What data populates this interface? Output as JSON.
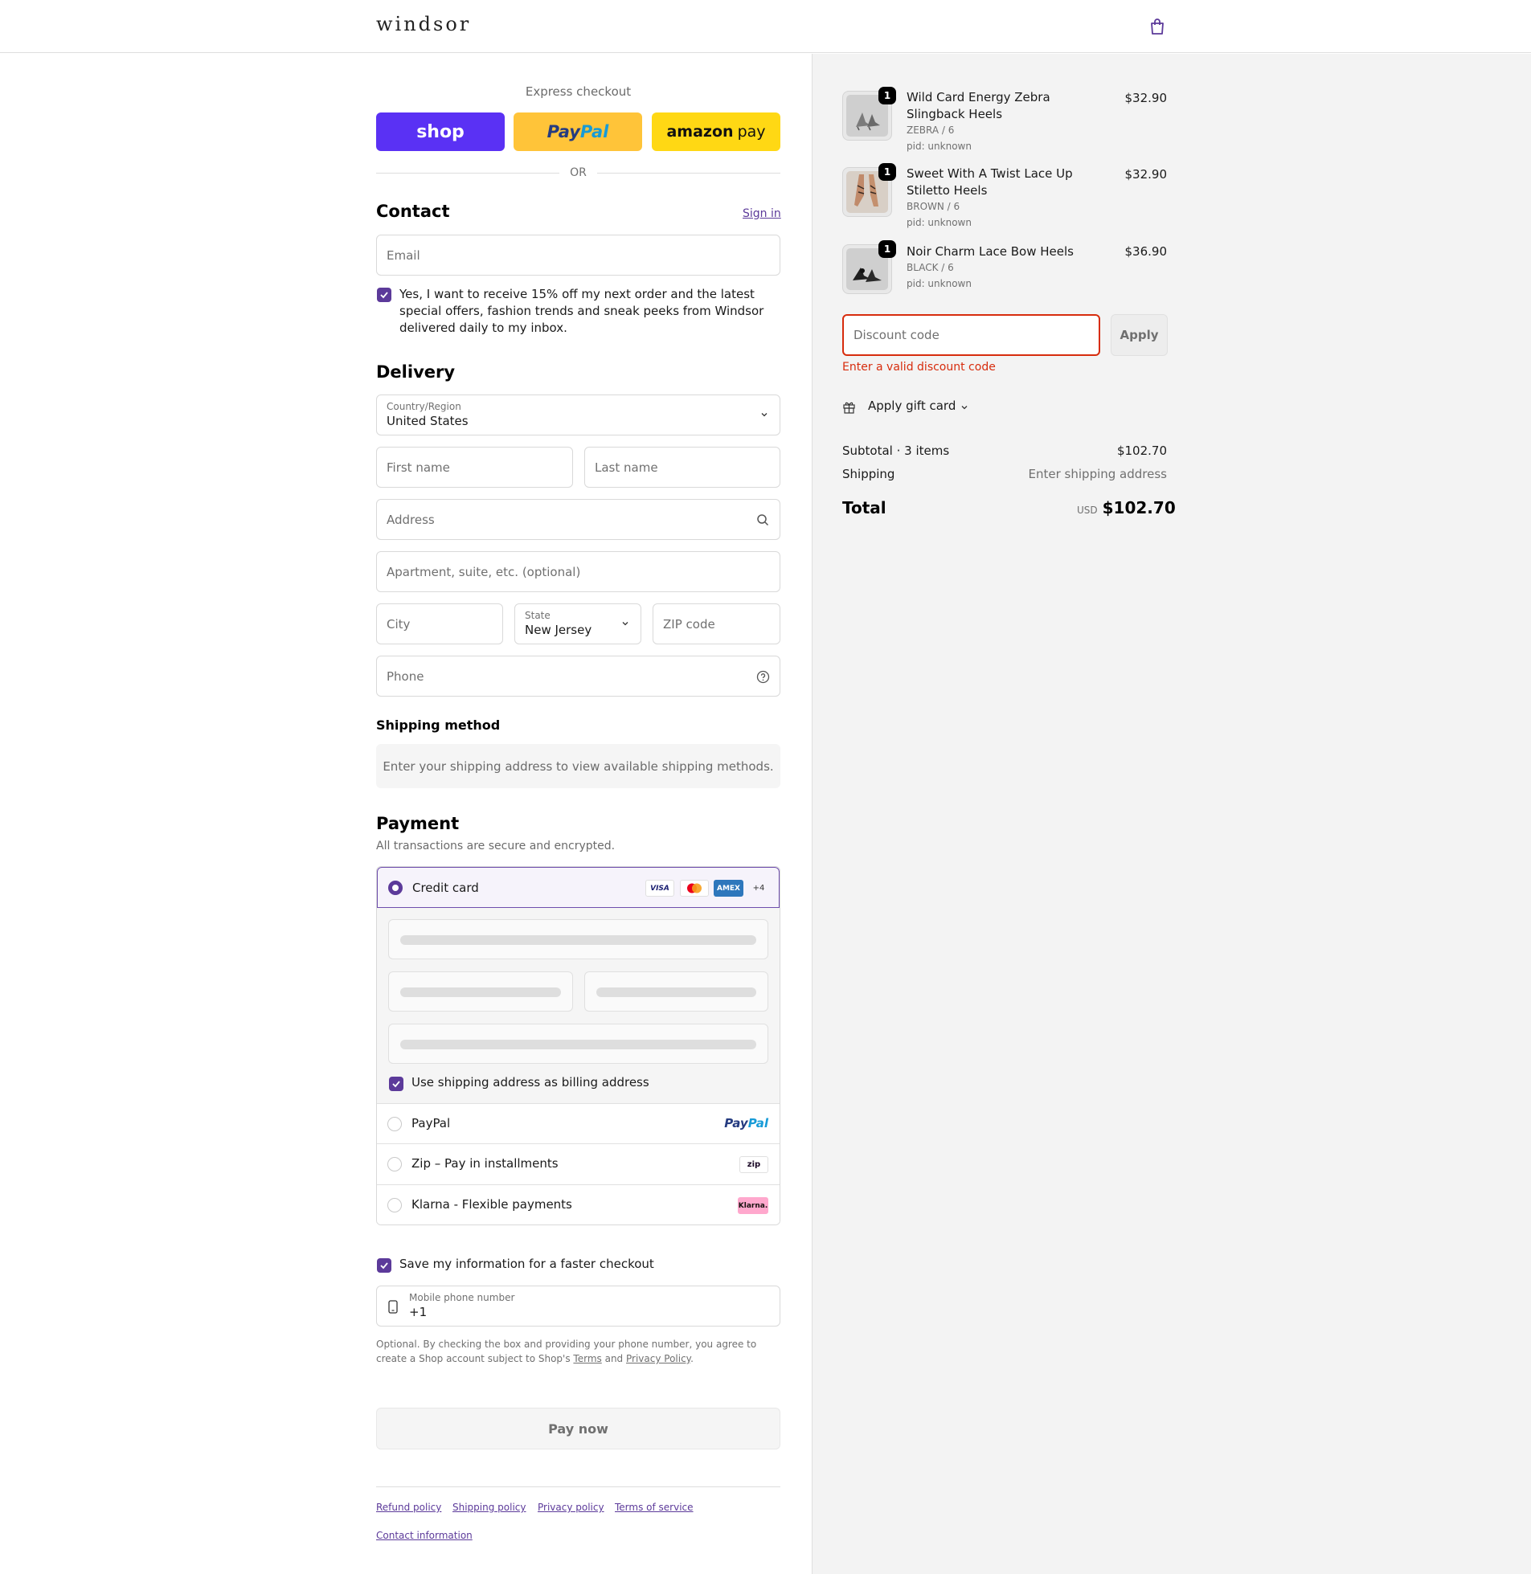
{
  "header": {
    "logo": "windsor",
    "cart_icon": "shopping-bag-icon"
  },
  "express": {
    "title": "Express checkout",
    "shop_label": "shop",
    "paypal_label_1": "Pay",
    "paypal_label_2": "Pal",
    "amazon_label_1": "amazon",
    "amazon_label_2": "pay",
    "or_label": "OR"
  },
  "contact": {
    "heading": "Contact",
    "sign_in": "Sign in",
    "email_placeholder": "Email",
    "marketing_optin": "Yes, I want to receive 15% off my next order and the latest special offers, fashion trends and sneak peeks from Windsor delivered daily to my inbox."
  },
  "delivery": {
    "heading": "Delivery",
    "country_label": "Country/Region",
    "country_value": "United States",
    "first_name": "First name",
    "last_name": "Last name",
    "address": "Address",
    "apartment": "Apartment, suite, etc. (optional)",
    "city": "City",
    "state_label": "State",
    "state_value": "New Jersey",
    "zip": "ZIP code",
    "phone": "Phone"
  },
  "shipping_method": {
    "heading": "Shipping method",
    "notice": "Enter your shipping address to view available shipping methods."
  },
  "payment": {
    "heading": "Payment",
    "subtitle": "All transactions are secure and encrypted.",
    "credit_card": "Credit card",
    "card_logos": [
      "VISA",
      "",
      "AMEX",
      "+4"
    ],
    "billing_same": "Use shipping address as billing address",
    "paypal": "PayPal",
    "paypal_logo_1": "Pay",
    "paypal_logo_2": "Pal",
    "zip": "Zip – Pay in installments",
    "zip_logo": "zip",
    "klarna": "Klarna - Flexible payments",
    "klarna_logo": "Klarna."
  },
  "save_info": {
    "label": "Save my information for a faster checkout",
    "mobile_label": "Mobile phone number",
    "mobile_value": "+1",
    "disclaimer_1": "Optional. By checking the box and providing your phone number, you agree to create a Shop account subject to Shop's",
    "terms": "Terms",
    "and": "and",
    "privacy": "Privacy Policy",
    "period": "."
  },
  "pay_now": "Pay now",
  "footer": {
    "links": [
      "Refund policy",
      "Shipping policy",
      "Privacy policy",
      "Terms of service"
    ],
    "contact": "Contact information"
  },
  "cart": {
    "items": [
      {
        "name": "Wild Card Energy Zebra Slingback Heels",
        "variant": "ZEBRA / 6",
        "pid": "pid: unknown",
        "price": "$32.90",
        "qty": "1"
      },
      {
        "name": "Sweet With A Twist Lace Up Stiletto Heels",
        "variant": "BROWN / 6",
        "pid": "pid: unknown",
        "price": "$32.90",
        "qty": "1"
      },
      {
        "name": "Noir Charm Lace Bow Heels",
        "variant": "BLACK / 6",
        "pid": "pid: unknown",
        "price": "$36.90",
        "qty": "1"
      }
    ],
    "discount_placeholder": "Discount code",
    "apply": "Apply",
    "discount_error": "Enter a valid discount code",
    "gift_card": "Apply gift card",
    "subtotal_label": "Subtotal · 3 items",
    "subtotal_value": "$102.70",
    "shipping_label": "Shipping",
    "shipping_value": "Enter shipping address",
    "total_label": "Total",
    "currency": "USD",
    "total_value": "$102.70"
  },
  "colors": {
    "accent": "#5c3a9a",
    "shop": "#5a31f4",
    "paypal": "#ffc439",
    "amazon": "#ffd814",
    "error": "#d72c0d"
  }
}
